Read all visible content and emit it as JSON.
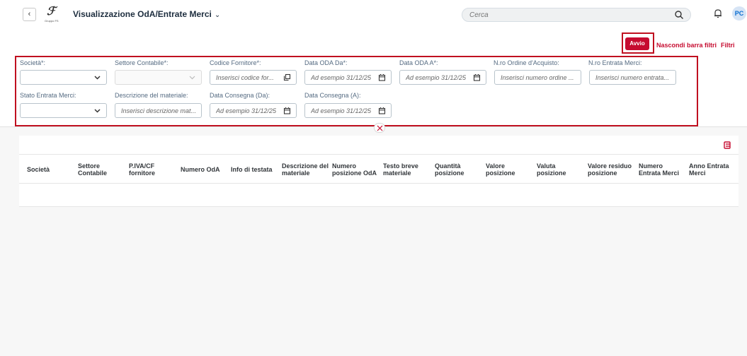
{
  "header": {
    "title": "Visualizzazione OdA/Entrate Merci",
    "title_chevron": "⌄",
    "back": "‹",
    "logo_mark": "ℱ",
    "logo_text": "Gruppo FS",
    "search_placeholder": "Cerca",
    "avatar_initials": "PC"
  },
  "toolbar": {
    "avvio": "Avvio",
    "hide_filters": "Nascondi barra filtri",
    "filters": "Filtri"
  },
  "filters": {
    "societa": {
      "label": "Società*:",
      "value": ""
    },
    "settore": {
      "label": "Settore Contabile*:",
      "value": ""
    },
    "fornitore": {
      "label": "Codice Fornitore*:",
      "placeholder": "Inserisci codice for..."
    },
    "data_oda_da": {
      "label": "Data ODA Da*:",
      "placeholder": "Ad esempio 31/12/25"
    },
    "data_oda_a": {
      "label": "Data ODA A*:",
      "placeholder": "Ad esempio 31/12/25"
    },
    "nro_ordine": {
      "label": "N.ro Ordine d'Acquisto:",
      "placeholder": "Inserisci numero ordine ..."
    },
    "nro_entrata": {
      "label": "N.ro Entrata Merci:",
      "placeholder": "Inserisci numero entrata..."
    },
    "stato": {
      "label": "Stato Entrata Merci:",
      "value": ""
    },
    "descrizione": {
      "label": "Descrizione del materiale:",
      "placeholder": "Inserisci descrizione mat..."
    },
    "consegna_da": {
      "label": "Data Consegna (Da):",
      "placeholder": "Ad esempio 31/12/25"
    },
    "consegna_a": {
      "label": "Data Consegna (A):",
      "placeholder": "Ad esempio 31/12/25"
    }
  },
  "table": {
    "columns": [
      [
        "Società",
        ""
      ],
      [
        "Settore",
        "Contabile"
      ],
      [
        "P.IVA/CF",
        "fornitore"
      ],
      [
        "Numero OdA",
        ""
      ],
      [
        "Info di testata",
        ""
      ],
      [
        "Descrizione del",
        "materiale"
      ],
      [
        "Numero",
        "posizione OdA"
      ],
      [
        "Testo breve",
        "materiale"
      ],
      [
        "Quantità",
        "posizione"
      ],
      [
        "Valore",
        "posizione"
      ],
      [
        "Valuta",
        "posizione"
      ],
      [
        "Valore residuo",
        "posizione"
      ],
      [
        "Numero",
        "Entrata Merci"
      ],
      [
        "Anno Entrata",
        "Merci"
      ]
    ]
  },
  "colors": {
    "accent": "#c60c30",
    "highlight": "#c01020"
  }
}
